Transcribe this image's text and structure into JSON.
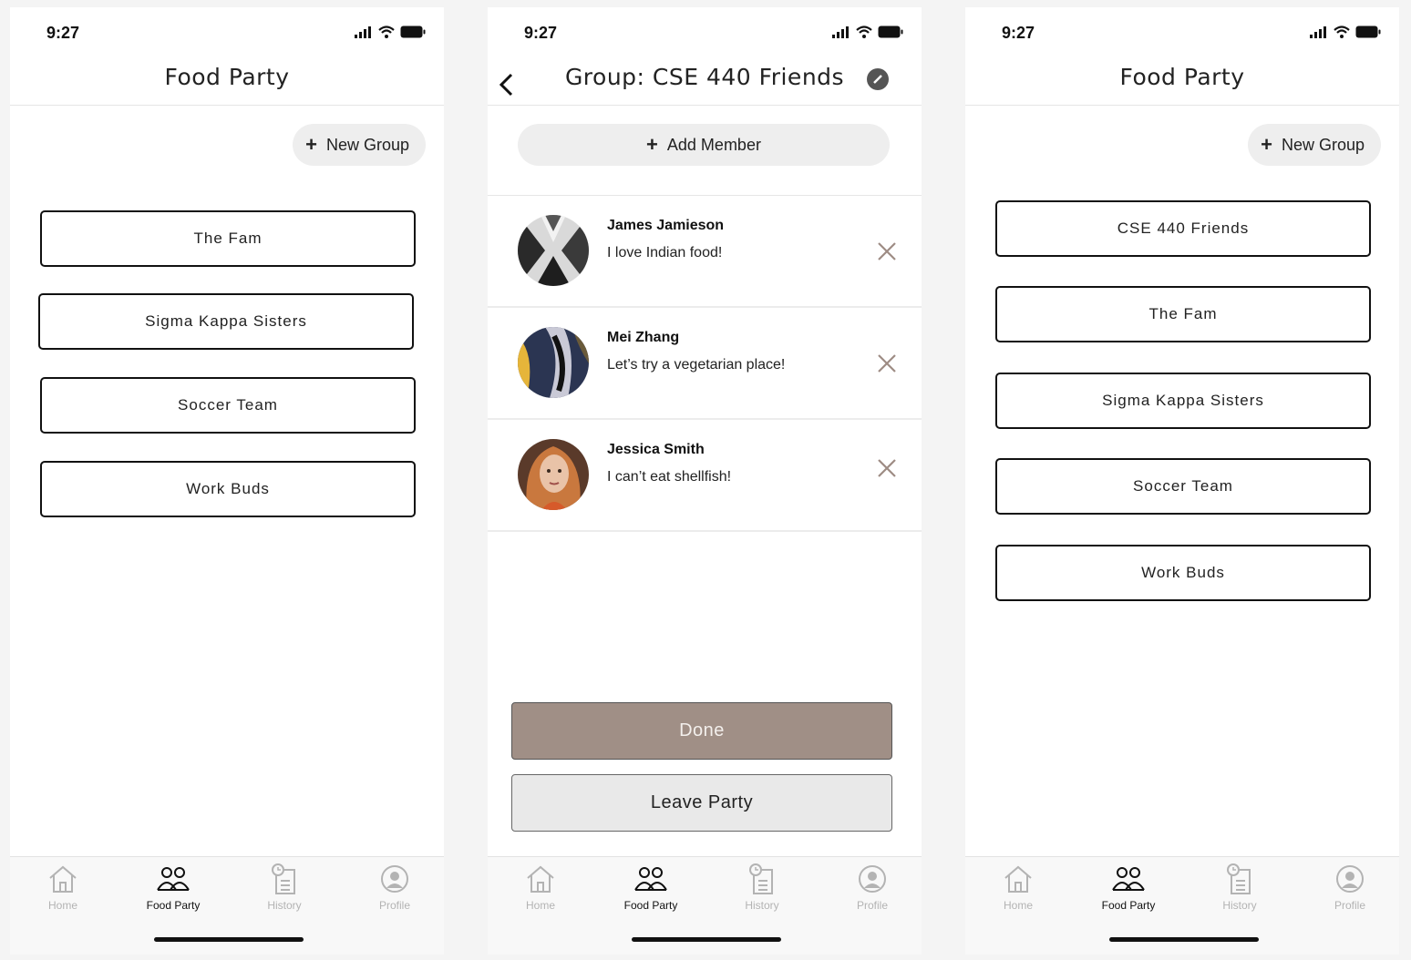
{
  "status": {
    "time": "9:27"
  },
  "screen1": {
    "title": "Food Party",
    "new_group_label": "New Group",
    "groups": [
      "The Fam",
      "Sigma Kappa Sisters",
      "Soccer Team",
      "Work Buds"
    ]
  },
  "screen2": {
    "title": "Group: CSE 440 Friends",
    "add_member_label": "Add Member",
    "members": [
      {
        "name": "James Jamieson",
        "message": "I love Indian food!"
      },
      {
        "name": "Mei Zhang",
        "message": "Let’s try a vegetarian place!"
      },
      {
        "name": "Jessica Smith",
        "message": "I can’t eat shellfish!"
      }
    ],
    "done_label": "Done",
    "leave_label": "Leave Party"
  },
  "screen3": {
    "title": "Food Party",
    "new_group_label": "New Group",
    "groups": [
      "CSE 440 Friends",
      "The Fam",
      "Sigma Kappa Sisters",
      "Soccer Team",
      "Work Buds"
    ]
  },
  "tabs": [
    "Home",
    "Food Party",
    "History",
    "Profile"
  ],
  "colors": {
    "done_button": "#a08f86",
    "tab_inactive": "#b3b3b3",
    "tab_active": "#111111"
  }
}
